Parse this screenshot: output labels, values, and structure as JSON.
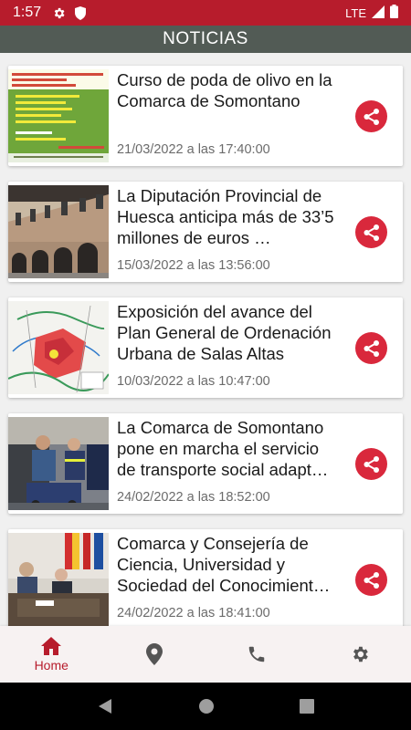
{
  "status_bar": {
    "time": "1:57",
    "network": "LTE",
    "icons": [
      "gear-icon",
      "shield-icon",
      "signal-icon",
      "battery-icon"
    ]
  },
  "app_bar": {
    "title": "NOTICIAS"
  },
  "news": [
    {
      "title": "Curso de poda de olivo en la Comarca de Somontano",
      "date": "21/03/2022 a las 17:40:00",
      "thumb": "poster"
    },
    {
      "title": "La Diputación Provincial de Huesca anticipa más de 33’5 millones de euros …",
      "date": "15/03/2022 a las 13:56:00",
      "thumb": "building"
    },
    {
      "title": "Exposición del avance del Plan General de Ordenación Urbana de Salas Altas",
      "date": "10/03/2022 a las 10:47:00",
      "thumb": "map"
    },
    {
      "title": "La Comarca de Somontano pone en marcha el servicio de transporte social adapt…",
      "date": "24/02/2022 a las 18:52:00",
      "thumb": "van"
    },
    {
      "title": "Comarca y Consejería de Ciencia, Universidad y Sociedad del Conocimient…",
      "date": "24/02/2022 a las 18:41:00",
      "thumb": "meeting"
    }
  ],
  "bottom_nav": {
    "items": [
      {
        "label": "Home",
        "icon": "home-icon",
        "active": true
      },
      {
        "label": "",
        "icon": "location-icon",
        "active": false
      },
      {
        "label": "",
        "icon": "phone-icon",
        "active": false
      },
      {
        "label": "",
        "icon": "settings-icon",
        "active": false
      }
    ]
  },
  "colors": {
    "accent": "#b71c2c",
    "share": "#d9283c",
    "app_bar": "#525b55"
  }
}
